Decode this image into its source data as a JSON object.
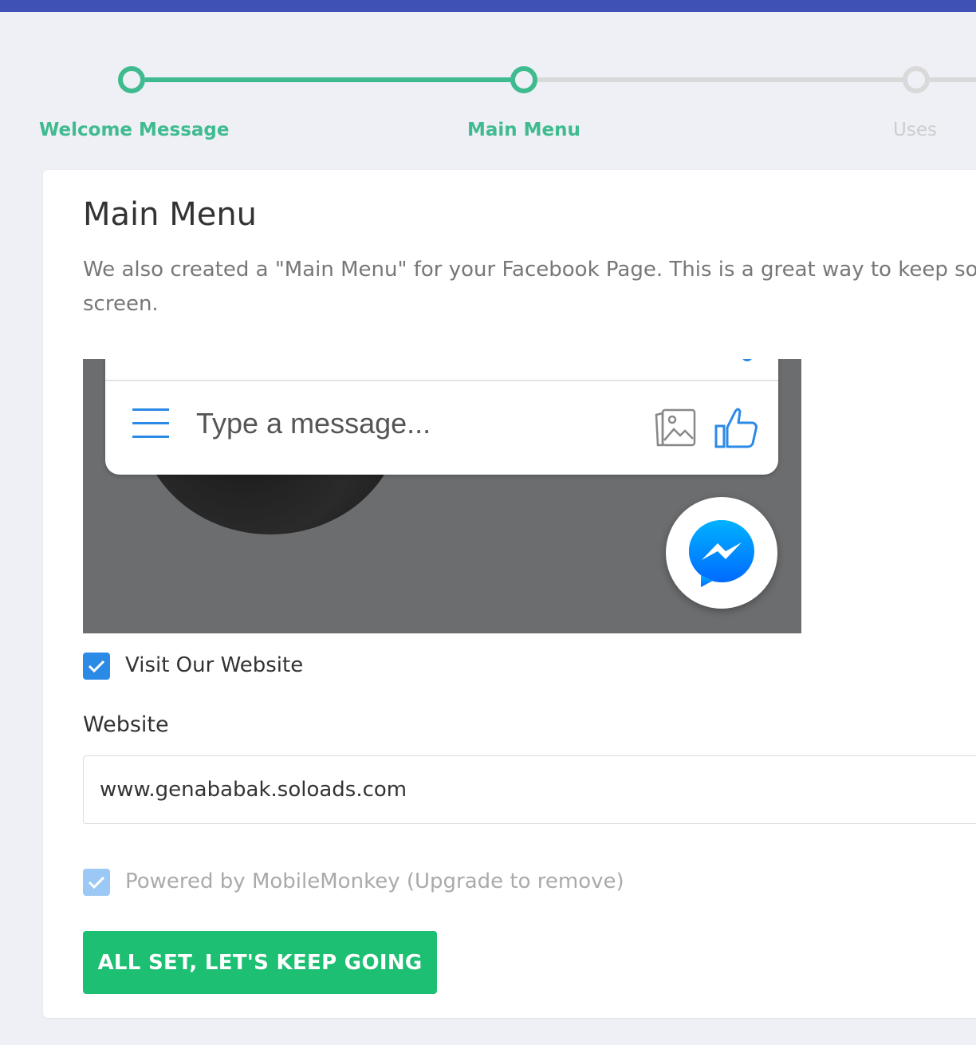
{
  "stepper": {
    "steps": [
      {
        "label": "Welcome Message",
        "state": "done"
      },
      {
        "label": "Main Menu",
        "state": "current"
      },
      {
        "label": "Uses",
        "state": "todo"
      }
    ]
  },
  "card": {
    "title": "Main Menu",
    "description_line1": "We also created a \"Main Menu\" for your Facebook Page. This is a great way to keep so",
    "description_line2": "screen."
  },
  "preview": {
    "chat_placeholder": "Type a message...",
    "icons": [
      "menu-icon",
      "photo-icon",
      "like-icon",
      "messenger-icon"
    ]
  },
  "form": {
    "visit_website": {
      "label": "Visit Our Website",
      "checked": true
    },
    "website": {
      "label": "Website",
      "value": "www.genababak.soloads.com"
    },
    "powered_by": {
      "label": "Powered by MobileMonkey (Upgrade to remove)",
      "checked": true,
      "disabled": true
    },
    "submit_label": "ALL SET, LET'S KEEP GOING"
  },
  "colors": {
    "top_bar": "#3f51b5",
    "step_done": "#3fbb8f",
    "step_todo": "#d9d9d9",
    "checkbox": "#2b8ae6",
    "button": "#1dbf73"
  }
}
